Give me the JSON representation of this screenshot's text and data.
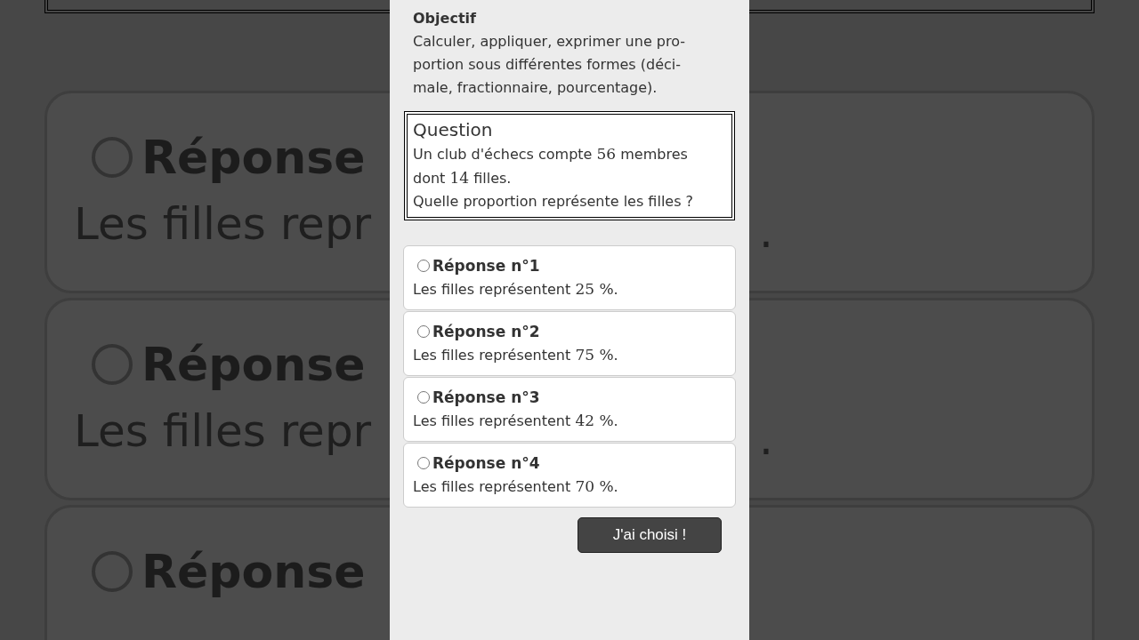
{
  "backdrop": {
    "cards": [
      {
        "heading": "Réponse",
        "text": "Les filles repr",
        "tail": "."
      },
      {
        "heading": "Réponse",
        "text": "Les filles repr",
        "tail": "."
      },
      {
        "heading": "Réponse"
      }
    ]
  },
  "objective": {
    "title": "Objectif",
    "lines": [
      "Calculer, appliquer, exprimer une pro-",
      "portion sous différentes formes (déci-",
      "male, fractionnaire, pourcentage)."
    ]
  },
  "question": {
    "title": "Question",
    "paragraphs": [
      [
        {
          "kind": "text",
          "text": "Un club d'échecs compte "
        },
        {
          "kind": "math",
          "text": "56"
        },
        {
          "kind": "text",
          "text": " membres dont "
        },
        {
          "kind": "math",
          "text": "14"
        },
        {
          "kind": "text",
          "text": " filles."
        }
      ],
      [
        {
          "kind": "text",
          "text": "Quelle proportion représente les filles ?"
        }
      ]
    ]
  },
  "answers": [
    {
      "label": "Réponse n°1",
      "text": "Les filles représentent ",
      "value": "25 %",
      "end": ".",
      "selected": false
    },
    {
      "label": "Réponse n°2",
      "text": "Les filles représentent ",
      "value": "75 %",
      "end": ".",
      "selected": false
    },
    {
      "label": "Réponse n°3",
      "text": "Les filles représentent ",
      "value": "42 %",
      "end": ".",
      "selected": false
    },
    {
      "label": "Réponse n°4",
      "text": "Les filles représentent ",
      "value": "70 %",
      "end": ".",
      "selected": false
    }
  ],
  "submit_button": "J'ai choisi !"
}
